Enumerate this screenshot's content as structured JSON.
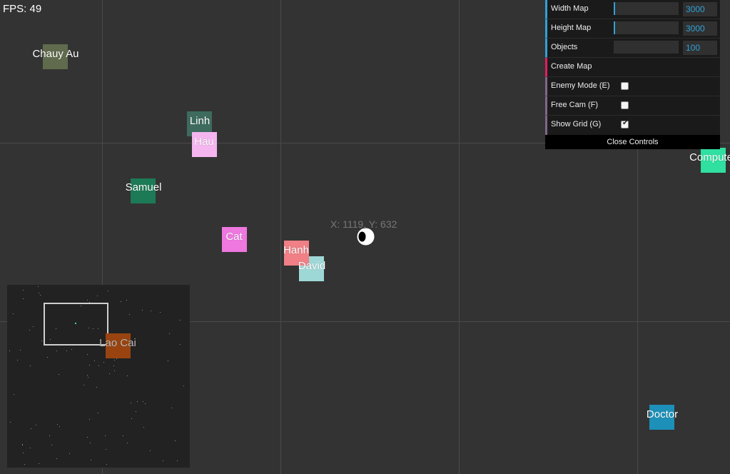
{
  "hud": {
    "fps_text": "FPS: 49",
    "coords_text": "X: 1119, Y: 632"
  },
  "entities": [
    {
      "name": "Chauy Au",
      "color": "#5f6b4c"
    },
    {
      "name": "Linh",
      "color": "#3e6b5e"
    },
    {
      "name": "Hau",
      "color": "#f5b6f0"
    },
    {
      "name": "Samuel",
      "color": "#1d7a56"
    },
    {
      "name": "Cat",
      "color": "#ee77e0"
    },
    {
      "name": "Hanh",
      "color": "#f07f86"
    },
    {
      "name": "David",
      "color": "#9ed8d6"
    },
    {
      "name": "Lao Cai",
      "color": "#994410"
    },
    {
      "name": "Computer",
      "color": "#2fe0a0"
    },
    {
      "name": "Doctor",
      "color": "#1c90b8"
    }
  ],
  "controls": {
    "width_map": {
      "label": "Width Map",
      "value": "3000"
    },
    "height_map": {
      "label": "Height Map",
      "value": "3000"
    },
    "objects": {
      "label": "Objects",
      "value": "100"
    },
    "create_map": {
      "label": "Create Map"
    },
    "enemy_mode": {
      "label": "Enemy Mode (E)",
      "checked": false
    },
    "free_cam": {
      "label": "Free Cam (F)",
      "checked": false
    },
    "show_grid": {
      "label": "Show Grid (G)",
      "checked": true
    },
    "close_label": "Close Controls"
  },
  "colors": {
    "background": "#333333",
    "grid": "#4a4a4a",
    "panel": "#1a1a1a",
    "number_accent": "#2fa1d6",
    "function_accent": "#e61d5f",
    "boolean_accent": "#806787"
  }
}
